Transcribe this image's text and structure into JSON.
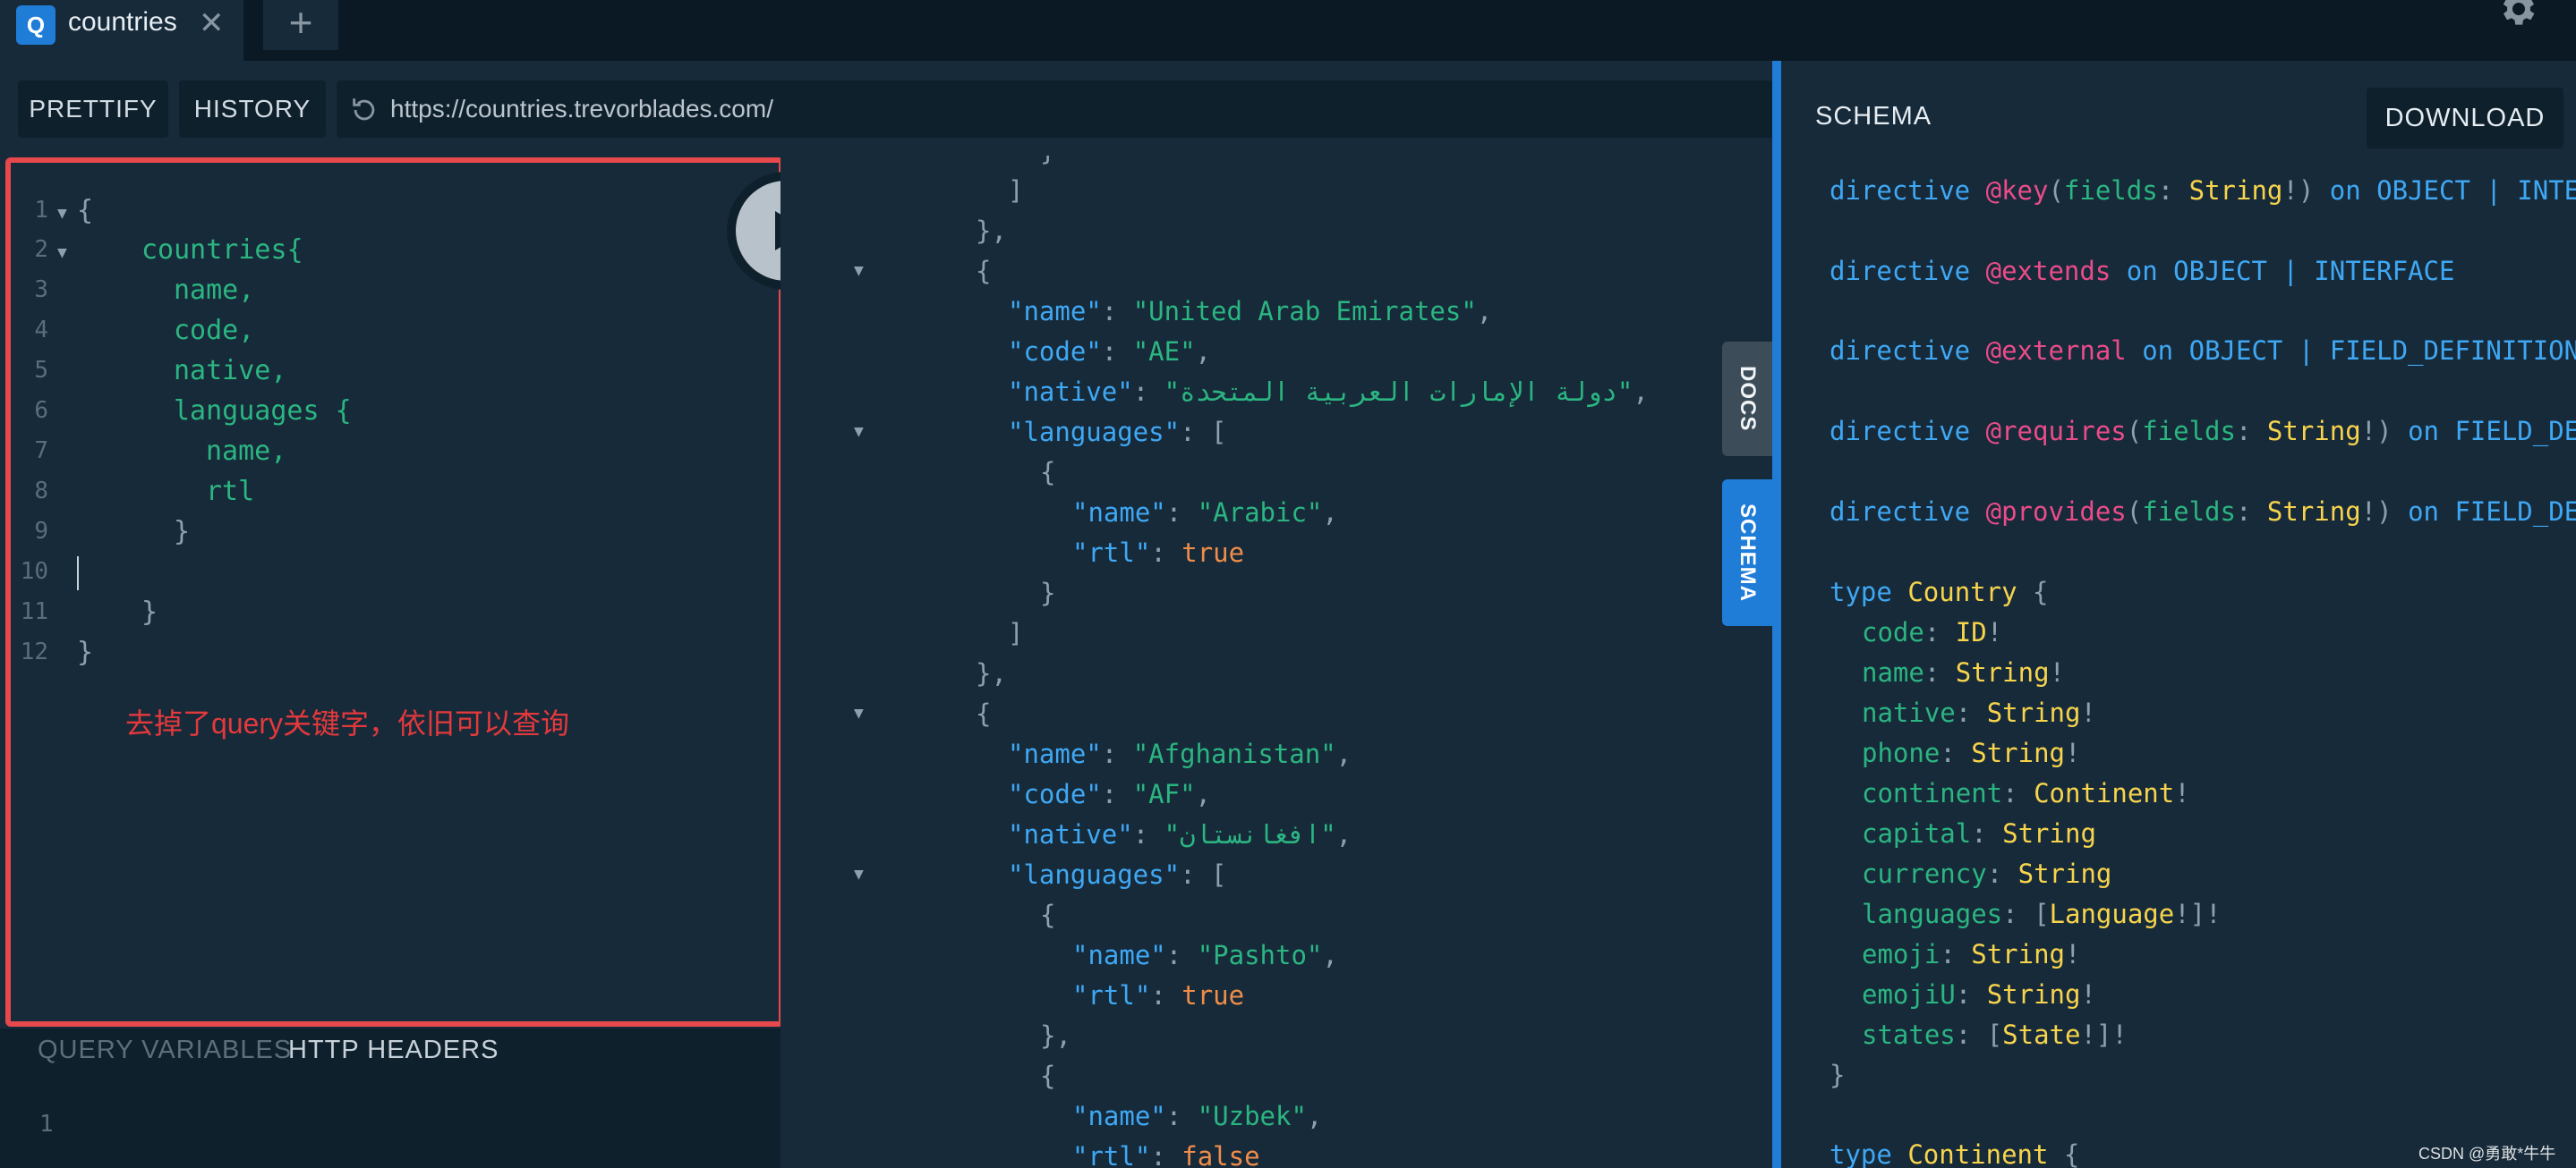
{
  "tab": {
    "icon_letter": "Q",
    "title": "countries",
    "close": "✕",
    "new_tab": "+"
  },
  "toolbar": {
    "prettify_label": "PRETTIFY",
    "history_label": "HISTORY",
    "url": "https://countries.trevorblades.com/"
  },
  "editor": {
    "line_numbers": [
      "1",
      "2",
      "3",
      "4",
      "5",
      "6",
      "7",
      "8",
      "9",
      "10",
      "11",
      "12"
    ],
    "lines": [
      "{",
      "countries{",
      "name,",
      "code,",
      "native,",
      "languages {",
      "name,",
      "rtl",
      "}",
      "",
      "}",
      "}"
    ],
    "annotation": "去掉了query关键字，依旧可以查询"
  },
  "variables": {
    "tab_query_variables": "QUERY VARIABLES",
    "tab_http_headers": "HTTP HEADERS",
    "line_number": "1"
  },
  "result": {
    "country1": {
      "name": "\"United Arab Emirates\"",
      "code": "\"AE\"",
      "native": "\"دولة الإمارات العربية المتحدة\""
    },
    "country1_lang": {
      "name": "\"Arabic\"",
      "rtl": "true"
    },
    "country2": {
      "name": "\"Afghanistan\"",
      "code": "\"AF\"",
      "native": "\"افغانستان\""
    },
    "country2_lang1": {
      "name": "\"Pashto\"",
      "rtl": "true"
    },
    "country2_lang2": {
      "name": "\"Uzbek\"",
      "rtl": "false"
    },
    "keys": {
      "name": "\"name\"",
      "code": "\"code\"",
      "native": "\"native\"",
      "languages": "\"languages\"",
      "rtl": "\"rtl\""
    }
  },
  "side_tabs": {
    "docs": "DOCS",
    "schema": "SCHEMA"
  },
  "schema": {
    "title": "SCHEMA",
    "download_label": "DOWNLOAD",
    "directives": [
      {
        "name": "@key",
        "args": "(fields: String!)",
        "locations": "OBJECT | INTE"
      },
      {
        "name": "@extends",
        "args": "",
        "locations": "OBJECT | INTERFACE"
      },
      {
        "name": "@external",
        "args": "",
        "locations": "OBJECT | FIELD_DEFINITION"
      },
      {
        "name": "@requires",
        "args": "(fields: String!)",
        "locations": "FIELD_DE"
      },
      {
        "name": "@provides",
        "args": "(fields: String!)",
        "locations": "FIELD_DE"
      }
    ],
    "country_type": {
      "name": "Country",
      "fields": [
        {
          "name": "code",
          "type": "ID",
          "suffix": "!"
        },
        {
          "name": "name",
          "type": "String",
          "suffix": "!"
        },
        {
          "name": "native",
          "type": "String",
          "suffix": "!"
        },
        {
          "name": "phone",
          "type": "String",
          "suffix": "!"
        },
        {
          "name": "continent",
          "type": "Continent",
          "suffix": "!"
        },
        {
          "name": "capital",
          "type": "String",
          "suffix": ""
        },
        {
          "name": "currency",
          "type": "String",
          "suffix": ""
        },
        {
          "name": "languages",
          "type": "Language",
          "suffix": "!]!",
          "prefix": "["
        },
        {
          "name": "emoji",
          "type": "String",
          "suffix": "!"
        },
        {
          "name": "emojiU",
          "type": "String",
          "suffix": "!"
        },
        {
          "name": "states",
          "type": "State",
          "suffix": "!]!",
          "prefix": "["
        }
      ]
    },
    "continent_type": {
      "name": "Continent"
    },
    "kw_directive": "directive",
    "kw_on": "on",
    "kw_type": "type"
  },
  "watermark": "CSDN @勇敢*牛牛",
  "colors": {
    "accent": "#1f7dd8",
    "highlight": "#e6484b",
    "string": "#2bb581",
    "key": "#3fa8f4",
    "bool": "#f08d49",
    "type": "#f7d44c",
    "directive": "#ea4c89"
  }
}
